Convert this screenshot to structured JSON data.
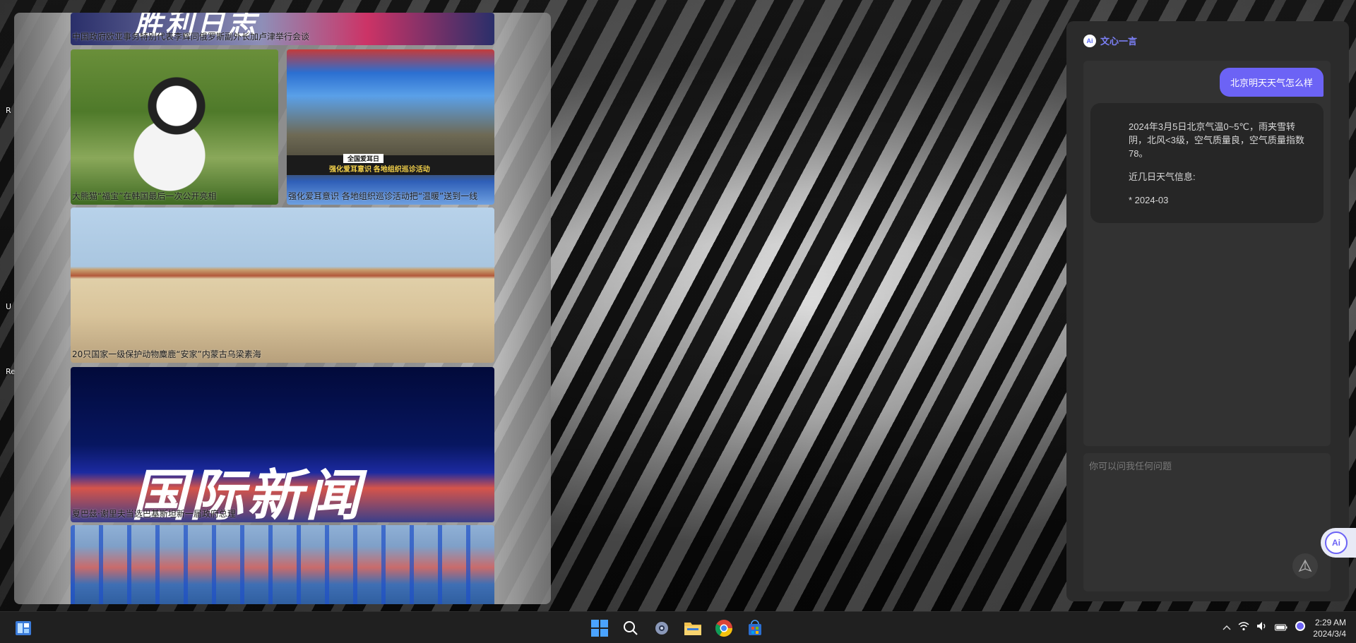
{
  "news": {
    "items": [
      {
        "caption": "中国政府欧亚事务特别代表李辉同俄罗斯副外长加卢津举行会谈",
        "banner_text": "胜利日志"
      },
      {
        "caption": "大熊猫“福宝”在韩国最后一次公开亮相"
      },
      {
        "caption": "强化爱耳意识 各地组织巡诊活动把“温暖”送到一线",
        "overlay_top": "全国爱耳日",
        "overlay_sub": "强化爱耳意识 各地组织巡诊活动"
      },
      {
        "caption": "20只国家一级保护动物麋鹿“安家”内蒙古乌梁素海"
      },
      {
        "caption": "夏巴兹·谢里夫当选巴基斯坦新一届政府总理",
        "banner_text": "国际新闻"
      },
      {
        "caption": ""
      }
    ]
  },
  "desktop": {
    "stubs": [
      "R",
      "U",
      "Re"
    ]
  },
  "ai_panel": {
    "app_name": "文心一言",
    "logo_text": "Ai",
    "user_message": "北京明天天气怎么样",
    "bot_reply": {
      "p1": "2024年3月5日北京气温0~5℃，雨夹雪转阴，北风<3级，空气质量良，空气质量指数78。",
      "p2": "近几日天气信息:",
      "p3": "* 2024-03"
    },
    "input_placeholder": "你可以问我任何问题"
  },
  "taskbar": {
    "icons": [
      "widgets-icon",
      "start-icon",
      "search-icon",
      "settings-icon",
      "file-explorer-icon",
      "chrome-icon",
      "store-icon"
    ],
    "tray": {
      "time": "2:29 AM",
      "date": "2024/3/4"
    }
  },
  "colors": {
    "accent": "#6c63f5",
    "panel_bg": "#2b2b2b",
    "taskbar_bg": "#202020"
  }
}
